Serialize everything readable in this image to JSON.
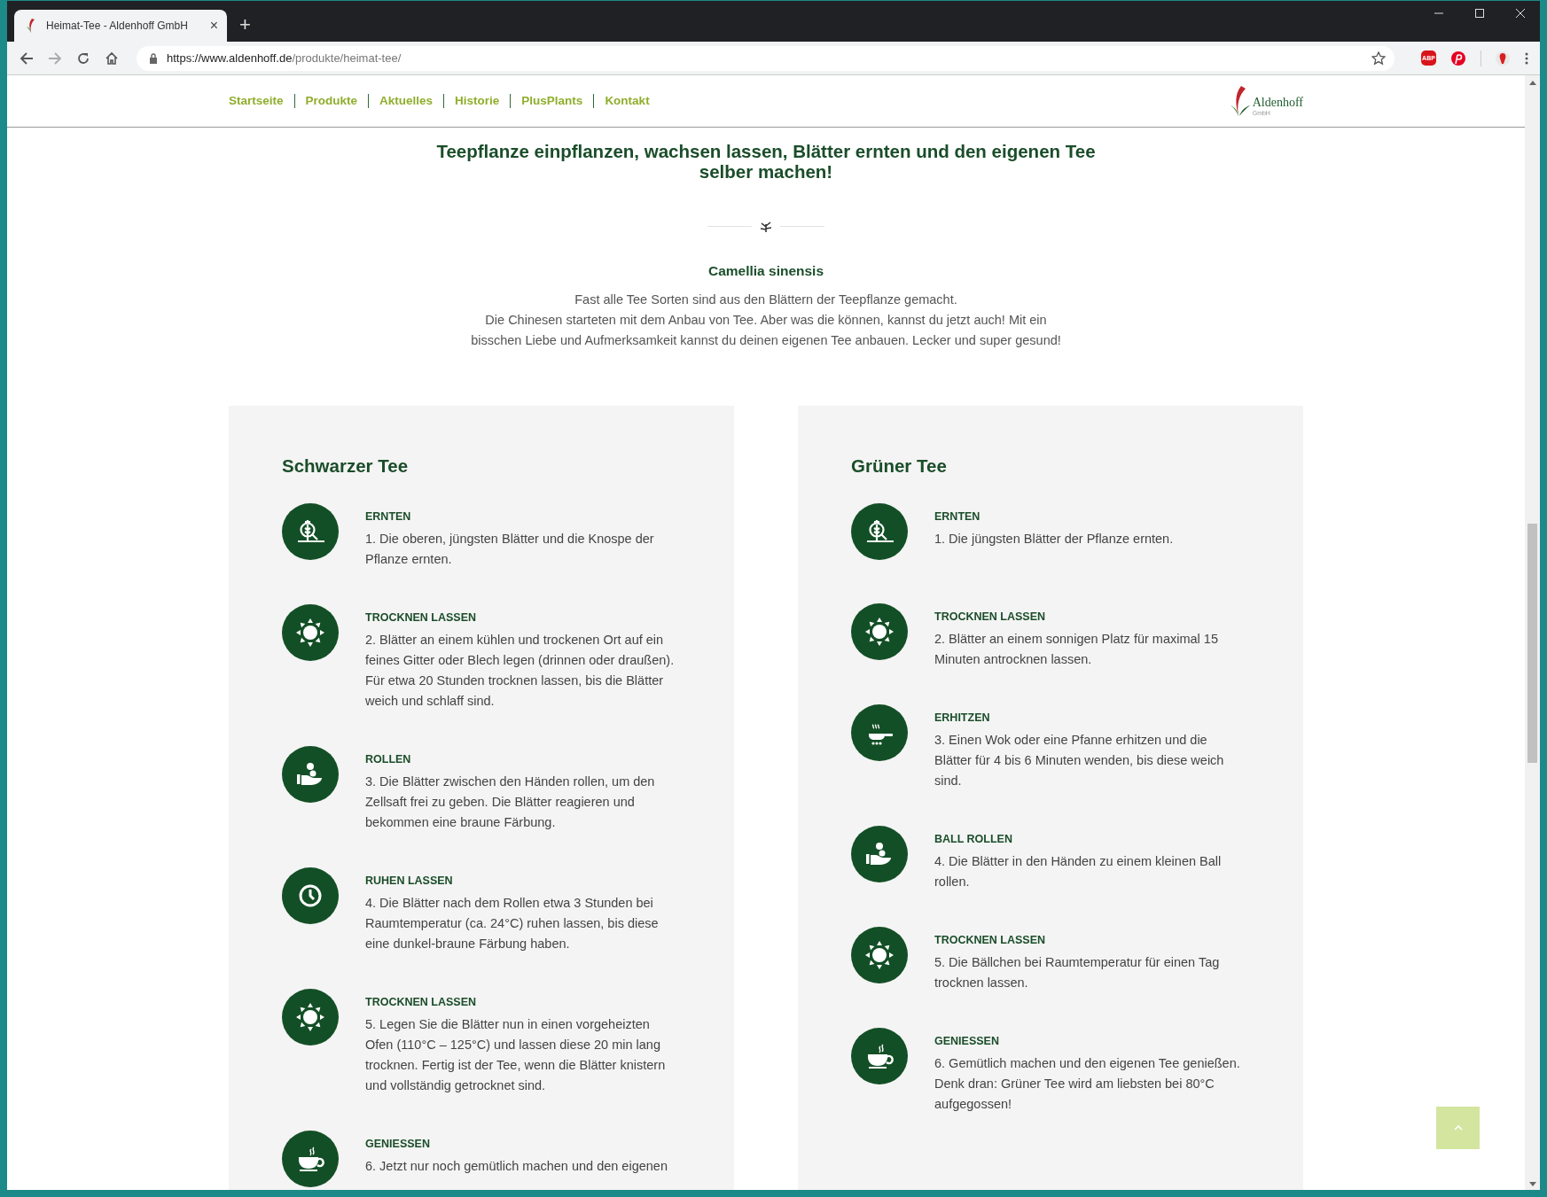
{
  "browser": {
    "tab": {
      "title": "Heimat-Tee - Aldenhoff GmbH",
      "close": "×",
      "selected": true
    },
    "new_tab": "+",
    "url": {
      "host": "https://www.aldenhoff.de",
      "path": "/produkte/heimat-tee/"
    },
    "extension_label": "ABP"
  },
  "nav": {
    "items": [
      {
        "label": "Startseite"
      },
      {
        "label": "Produkte"
      },
      {
        "label": "Aktuelles"
      },
      {
        "label": "Historie"
      },
      {
        "label": "PlusPlants"
      },
      {
        "label": "Kontakt"
      }
    ],
    "logo": {
      "name": "Aldenhoff",
      "sub": "GmbH"
    }
  },
  "headline": "Teepflanze einpflanzen, wachsen lassen, Blätter ernten und den eigenen Tee selber machen!",
  "intro": {
    "title": "Camellia sinensis",
    "lines": [
      "Fast alle Tee Sorten sind aus den Blättern der Teepflanze gemacht.",
      "Die Chinesen starteten mit dem Anbau von Tee. Aber was die können, kannst du jetzt auch! Mit ein bisschen Liebe und Aufmerksamkeit kannst du deinen eigenen Tee anbauen. Lecker und super gesund!"
    ]
  },
  "cards": [
    {
      "title": "Schwarzer Tee",
      "steps": [
        {
          "kind": "harvest",
          "title": "ERNTEN",
          "text": "1. Die oberen, jüngsten Blätter und die Knospe der Pflanze ernten."
        },
        {
          "kind": "sun",
          "title": "TROCKNEN LASSEN",
          "text": "2. Blätter an einem kühlen und trockenen Ort auf ein feines Gitter oder Blech legen (drinnen oder draußen). Für etwa 20 Stunden trocknen lassen, bis die Blätter weich und schlaff sind."
        },
        {
          "kind": "hands",
          "title": "ROLLEN",
          "text": "3. Die Blätter zwischen den Händen rollen, um den Zellsaft frei zu geben. Die Blätter reagieren und bekommen eine braune Färbung."
        },
        {
          "kind": "clock",
          "title": "RUHEN LASSEN",
          "text": "4. Die Blätter nach dem Rollen etwa 3 Stunden bei Raumtemperatur (ca. 24°C) ruhen lassen, bis diese eine dunkel-braune Färbung haben."
        },
        {
          "kind": "sun",
          "title": "TROCKNEN LASSEN",
          "text": "5. Legen Sie die Blätter nun in einen vorgeheizten Ofen (110°C – 125°C) und lassen diese 20 min lang trocknen. Fertig ist der Tee, wenn die Blätter knistern und vollständig getrocknet sind."
        },
        {
          "kind": "cup",
          "title": "GENIESSEN",
          "text": "6. Jetzt nur noch gemütlich machen und den eigenen"
        }
      ]
    },
    {
      "title": "Grüner Tee",
      "steps": [
        {
          "kind": "harvest",
          "title": "ERNTEN",
          "text": "1. Die jüngsten Blätter der Pflanze ernten."
        },
        {
          "kind": "sun",
          "title": "TROCKNEN LASSEN",
          "text": "2. Blätter an einem sonnigen Platz für maximal 15 Minuten antrocknen lassen."
        },
        {
          "kind": "pan",
          "title": "ERHITZEN",
          "text": "3. Einen Wok oder eine Pfanne erhitzen und die Blätter für 4 bis 6 Minuten wenden, bis diese weich sind."
        },
        {
          "kind": "hands",
          "title": "BALL ROLLEN",
          "text": "4. Die Blätter in den Händen zu einem kleinen Ball rollen."
        },
        {
          "kind": "sun",
          "title": "TROCKNEN LASSEN",
          "text": "5. Die Bällchen bei Raumtemperatur für einen Tag trocknen lassen."
        },
        {
          "kind": "cup",
          "title": "GENIESSEN",
          "text": "6. Gemütlich machen und den eigenen Tee genießen. Denk dran: Grüner Tee wird am liebsten bei 80°C aufgegossen!"
        }
      ]
    }
  ]
}
